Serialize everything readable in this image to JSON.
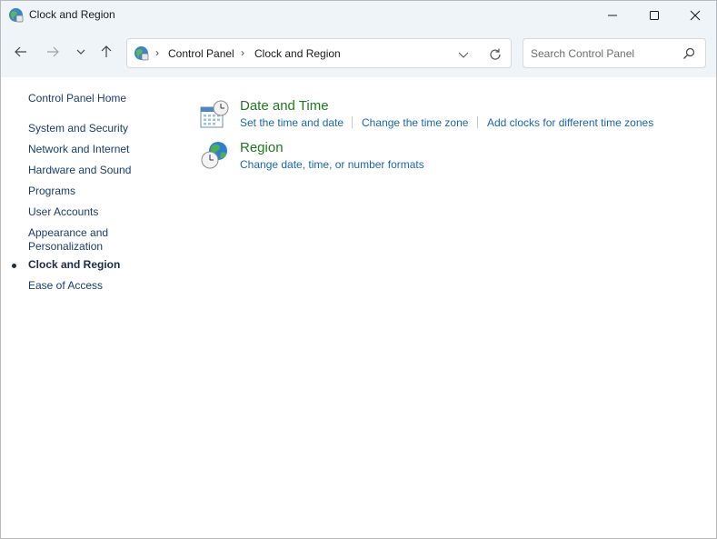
{
  "window": {
    "title": "Clock and Region",
    "icon": "control-panel-globe-icon",
    "controls": {
      "minimize_icon": "minimize-icon",
      "maximize_icon": "maximize-icon",
      "close_icon": "close-icon"
    }
  },
  "navigation": {
    "back_icon": "arrow-left-icon",
    "forward_icon": "arrow-right-icon",
    "recent_icon": "chevron-down-icon",
    "up_icon": "arrow-up-icon"
  },
  "address_bar": {
    "breadcrumbs": [
      "Control Panel",
      "Clock and Region"
    ],
    "separator": "›"
  },
  "search": {
    "placeholder": "Search Control Panel",
    "value": ""
  },
  "sidebar": {
    "home": "Control Panel Home",
    "items": [
      "System and Security",
      "Network and Internet",
      "Hardware and Sound",
      "Programs",
      "User Accounts",
      "Appearance and",
      "Personalization",
      "Clock and Region",
      "Ease of Access"
    ],
    "current": "Clock and Region"
  },
  "categories": [
    {
      "title": "Date and Time",
      "icon": "calendar-clock-icon",
      "links": [
        "Set the time and date",
        "Change the time zone",
        "Add clocks for different time zones"
      ]
    },
    {
      "title": "Region",
      "icon": "globe-clock-icon",
      "links": [
        "Change date, time, or number formats"
      ]
    }
  ],
  "colors": {
    "title_bar": "#eff4f9",
    "link": "#1a66b5",
    "category_title": "#1e7b1e",
    "sidebar_link": "#1a3e6e"
  }
}
